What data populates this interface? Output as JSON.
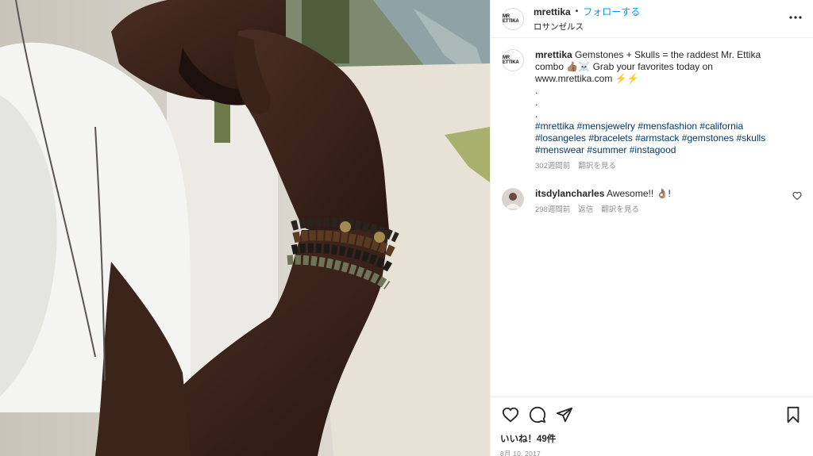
{
  "post": {
    "username": "mrettika",
    "avatar_text": "MR ETTIKA",
    "dot": "•",
    "follow_label": "フォローする",
    "location": "ロサンゼルス",
    "more_icon": "more-horizontal-icon"
  },
  "caption": {
    "username": "mrettika",
    "text": "Gemstones + Skulls = the raddest Mr. Ettika combo 👍🏽☠️ Grab your favorites today on www.mrettika.com ⚡️⚡️\n.\n.\n.",
    "hashtags": "#mrettika #mensjewelry #mensfashion #california #losangeles #bracelets #armstack #gemstones #skulls #menswear #summer #instagood",
    "time": "302週間前",
    "translate": "翻訳を見る"
  },
  "comments": [
    {
      "username": "itsdylancharles",
      "text": "Awesome!! 👌🏽!",
      "time": "298週間前",
      "reply": "返信",
      "translate": "翻訳を見る"
    }
  ],
  "actions": {
    "likes": "いいね！49件",
    "date": "8月 10, 2017"
  },
  "colors": {
    "link": "#0095f6",
    "hashtag": "#00376b",
    "muted": "#8e8e8e"
  }
}
